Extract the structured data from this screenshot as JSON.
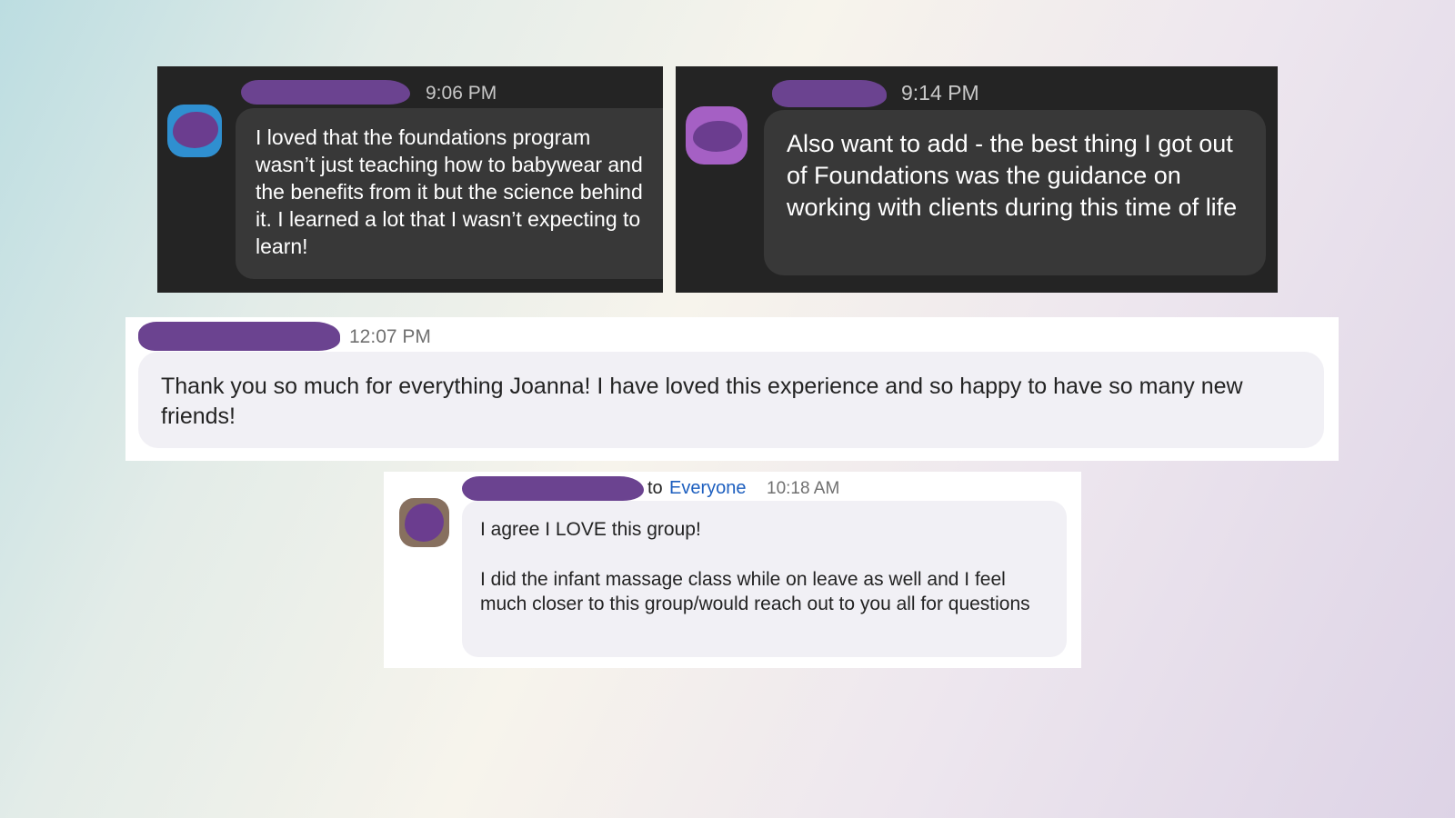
{
  "messages": [
    {
      "time": "9:06 PM",
      "text": "I loved that the foundations program wasn’t just teaching how to babywear and the benefits from it but the science behind it. I learned a lot that I wasn’t expecting to learn!",
      "avatar_color": "#2f8fd0"
    },
    {
      "time": "9:14 PM",
      "text": "Also want to add - the best thing I got out of Foundations was the guidance on working with clients during this time of life",
      "avatar_color": "#a560c4"
    },
    {
      "time": "12:07 PM",
      "text": "Thank you so much for everything Joanna! I have loved this experience and so happy to have so many new friends!"
    },
    {
      "to_prefix": "to",
      "recipient": "Everyone",
      "time": "10:18 AM",
      "line1": "I agree I LOVE this group!",
      "line2": "I did the infant massage class while on leave as well and I feel much closer to this group/would reach out to you all for questions",
      "avatar_color": "#87705f"
    }
  ],
  "colors": {
    "redaction": "#6b4390",
    "link": "#1d5fbf"
  }
}
